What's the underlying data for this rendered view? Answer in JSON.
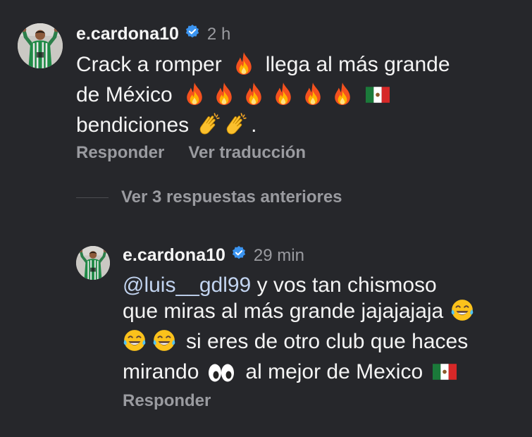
{
  "comment": {
    "username": "e.cardona10",
    "time": "2 h",
    "line1_a": "Crack a romper",
    "line1_b": "llega al más grande",
    "line2": "de México",
    "line3": "bendiciones",
    "line3_end": ".",
    "actions": {
      "reply": "Responder",
      "translate": "Ver traducción"
    }
  },
  "view_replies": "Ver 3 respuestas anteriores",
  "reply": {
    "username": "e.cardona10",
    "time": "29 min",
    "mention": "@luis__gdl99",
    "line1_rest": "y vos tan chismoso",
    "line2": "que miras al más grande jajajajaja",
    "line3": "si eres de otro club que haces",
    "line4_a": "mirando",
    "line4_b": "al mejor de Mexico",
    "actions": {
      "reply": "Responder"
    }
  },
  "icons": [
    "verified-badge-icon",
    "fire-emoji-icon",
    "mexico-flag-icon",
    "clapping-hands-icon",
    "laughing-tears-icon",
    "eyes-emoji-icon"
  ],
  "colors": {
    "background": "#26272b",
    "secondary_text": "#9a9ba0",
    "mention": "#c2d4f0",
    "verified": "#3b94f0"
  }
}
